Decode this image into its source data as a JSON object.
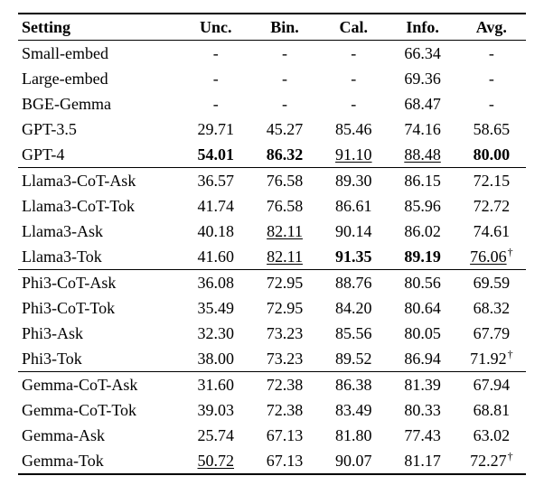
{
  "chart_data": {
    "type": "table",
    "title": "",
    "columns": [
      "Setting",
      "Unc.",
      "Bin.",
      "Cal.",
      "Info.",
      "Avg."
    ],
    "groups": [
      {
        "rows": [
          {
            "setting": "Small-embed",
            "unc": "-",
            "bin": "-",
            "cal": "-",
            "info": "66.34",
            "avg": "-"
          },
          {
            "setting": "Large-embed",
            "unc": "-",
            "bin": "-",
            "cal": "-",
            "info": "69.36",
            "avg": "-"
          },
          {
            "setting": "BGE-Gemma",
            "unc": "-",
            "bin": "-",
            "cal": "-",
            "info": "68.47",
            "avg": "-"
          },
          {
            "setting": "GPT-3.5",
            "unc": "29.71",
            "bin": "45.27",
            "cal": "85.46",
            "info": "74.16",
            "avg": "58.65"
          },
          {
            "setting": "GPT-4",
            "unc": "54.01",
            "bin": "86.32",
            "cal": "91.10",
            "info": "88.48",
            "avg": "80.00",
            "bold": [
              "unc",
              "bin",
              "avg"
            ],
            "underline": [
              "cal",
              "info"
            ]
          }
        ]
      },
      {
        "rows": [
          {
            "setting": "Llama3-CoT-Ask",
            "unc": "36.57",
            "bin": "76.58",
            "cal": "89.30",
            "info": "86.15",
            "avg": "72.15"
          },
          {
            "setting": "Llama3-CoT-Tok",
            "unc": "41.74",
            "bin": "76.58",
            "cal": "86.61",
            "info": "85.96",
            "avg": "72.72"
          },
          {
            "setting": "Llama3-Ask",
            "unc": "40.18",
            "bin": "82.11",
            "cal": "90.14",
            "info": "86.02",
            "avg": "74.61",
            "underline": [
              "bin"
            ]
          },
          {
            "setting": "Llama3-Tok",
            "unc": "41.60",
            "bin": "82.11",
            "cal": "91.35",
            "info": "89.19",
            "avg": "76.06",
            "underline": [
              "bin",
              "avg"
            ],
            "bold": [
              "cal",
              "info"
            ],
            "dagger": [
              "avg"
            ]
          }
        ]
      },
      {
        "rows": [
          {
            "setting": "Phi3-CoT-Ask",
            "unc": "36.08",
            "bin": "72.95",
            "cal": "88.76",
            "info": "80.56",
            "avg": "69.59"
          },
          {
            "setting": "Phi3-CoT-Tok",
            "unc": "35.49",
            "bin": "72.95",
            "cal": "84.20",
            "info": "80.64",
            "avg": "68.32"
          },
          {
            "setting": "Phi3-Ask",
            "unc": "32.30",
            "bin": "73.23",
            "cal": "85.56",
            "info": "80.05",
            "avg": "67.79"
          },
          {
            "setting": "Phi3-Tok",
            "unc": "38.00",
            "bin": "73.23",
            "cal": "89.52",
            "info": "86.94",
            "avg": "71.92",
            "dagger": [
              "avg"
            ]
          }
        ]
      },
      {
        "rows": [
          {
            "setting": "Gemma-CoT-Ask",
            "unc": "31.60",
            "bin": "72.38",
            "cal": "86.38",
            "info": "81.39",
            "avg": "67.94"
          },
          {
            "setting": "Gemma-CoT-Tok",
            "unc": "39.03",
            "bin": "72.38",
            "cal": "83.49",
            "info": "80.33",
            "avg": "68.81"
          },
          {
            "setting": "Gemma-Ask",
            "unc": "25.74",
            "bin": "67.13",
            "cal": "81.80",
            "info": "77.43",
            "avg": "63.02"
          },
          {
            "setting": "Gemma-Tok",
            "unc": "50.72",
            "bin": "67.13",
            "cal": "90.07",
            "info": "81.17",
            "avg": "72.27",
            "underline": [
              "unc"
            ],
            "dagger": [
              "avg"
            ]
          }
        ]
      }
    ]
  },
  "headers": {
    "setting": "Setting",
    "unc": "Unc.",
    "bin": "Bin.",
    "cal": "Cal.",
    "info": "Info.",
    "avg": "Avg."
  }
}
